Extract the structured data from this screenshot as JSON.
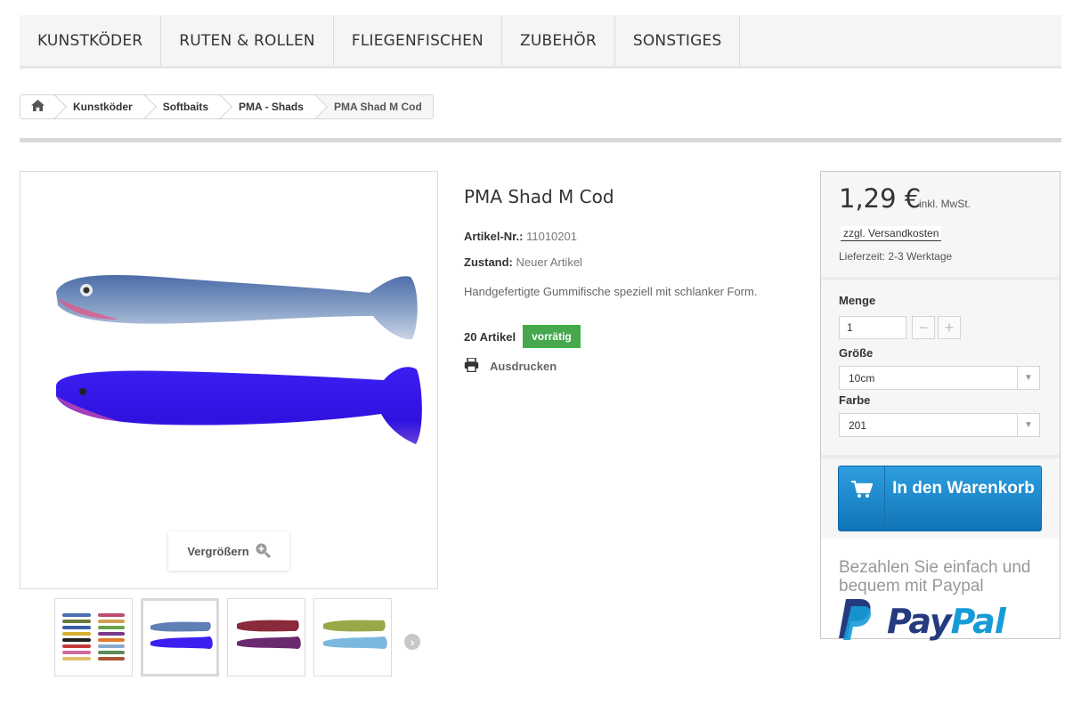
{
  "nav": {
    "items": [
      "KUNSTKÖDER",
      "RUTEN & ROLLEN",
      "FLIEGENFISCHEN",
      "ZUBEHÖR",
      "SONSTIGES"
    ]
  },
  "breadcrumb": {
    "home_icon": "home-icon",
    "items": [
      "Kunstköder",
      "Softbaits",
      "PMA - Shads",
      "PMA Shad M Cod"
    ]
  },
  "product": {
    "title": "PMA Shad M Cod",
    "sku_label": "Artikel-Nr.:",
    "sku": "11010201",
    "condition_label": "Zustand:",
    "condition": "Neuer Artikel",
    "description": "Handgefertigte Gummifische speziell mit schlanker Form.",
    "stock_count": "20 Artikel",
    "stock_status": "vorrätig",
    "print_label": "Ausdrucken"
  },
  "gallery": {
    "zoom_label": "Vergrößern",
    "thumbnail_count": 4,
    "active_thumbnail": 2
  },
  "buy": {
    "price": "1,29 €",
    "tax_note": "inkl. MwSt.",
    "shipping_link": "zzgl. Versandkosten",
    "delivery": "Lieferzeit: 2-3 Werktage",
    "qty_label": "Menge",
    "qty_value": "1",
    "size_label": "Größe",
    "size_value": "10cm",
    "color_label": "Farbe",
    "color_value": "201",
    "cart_label": "In den Warenkorb",
    "paypal_text": "Bezahlen Sie einfach und bequem mit Paypal",
    "paypal_brand": "PayPal"
  },
  "colors": {
    "stock_badge": "#46a74e",
    "cart_button": "#1f8fd3",
    "paypal_dark": "#253b80",
    "paypal_light": "#179bd7"
  }
}
